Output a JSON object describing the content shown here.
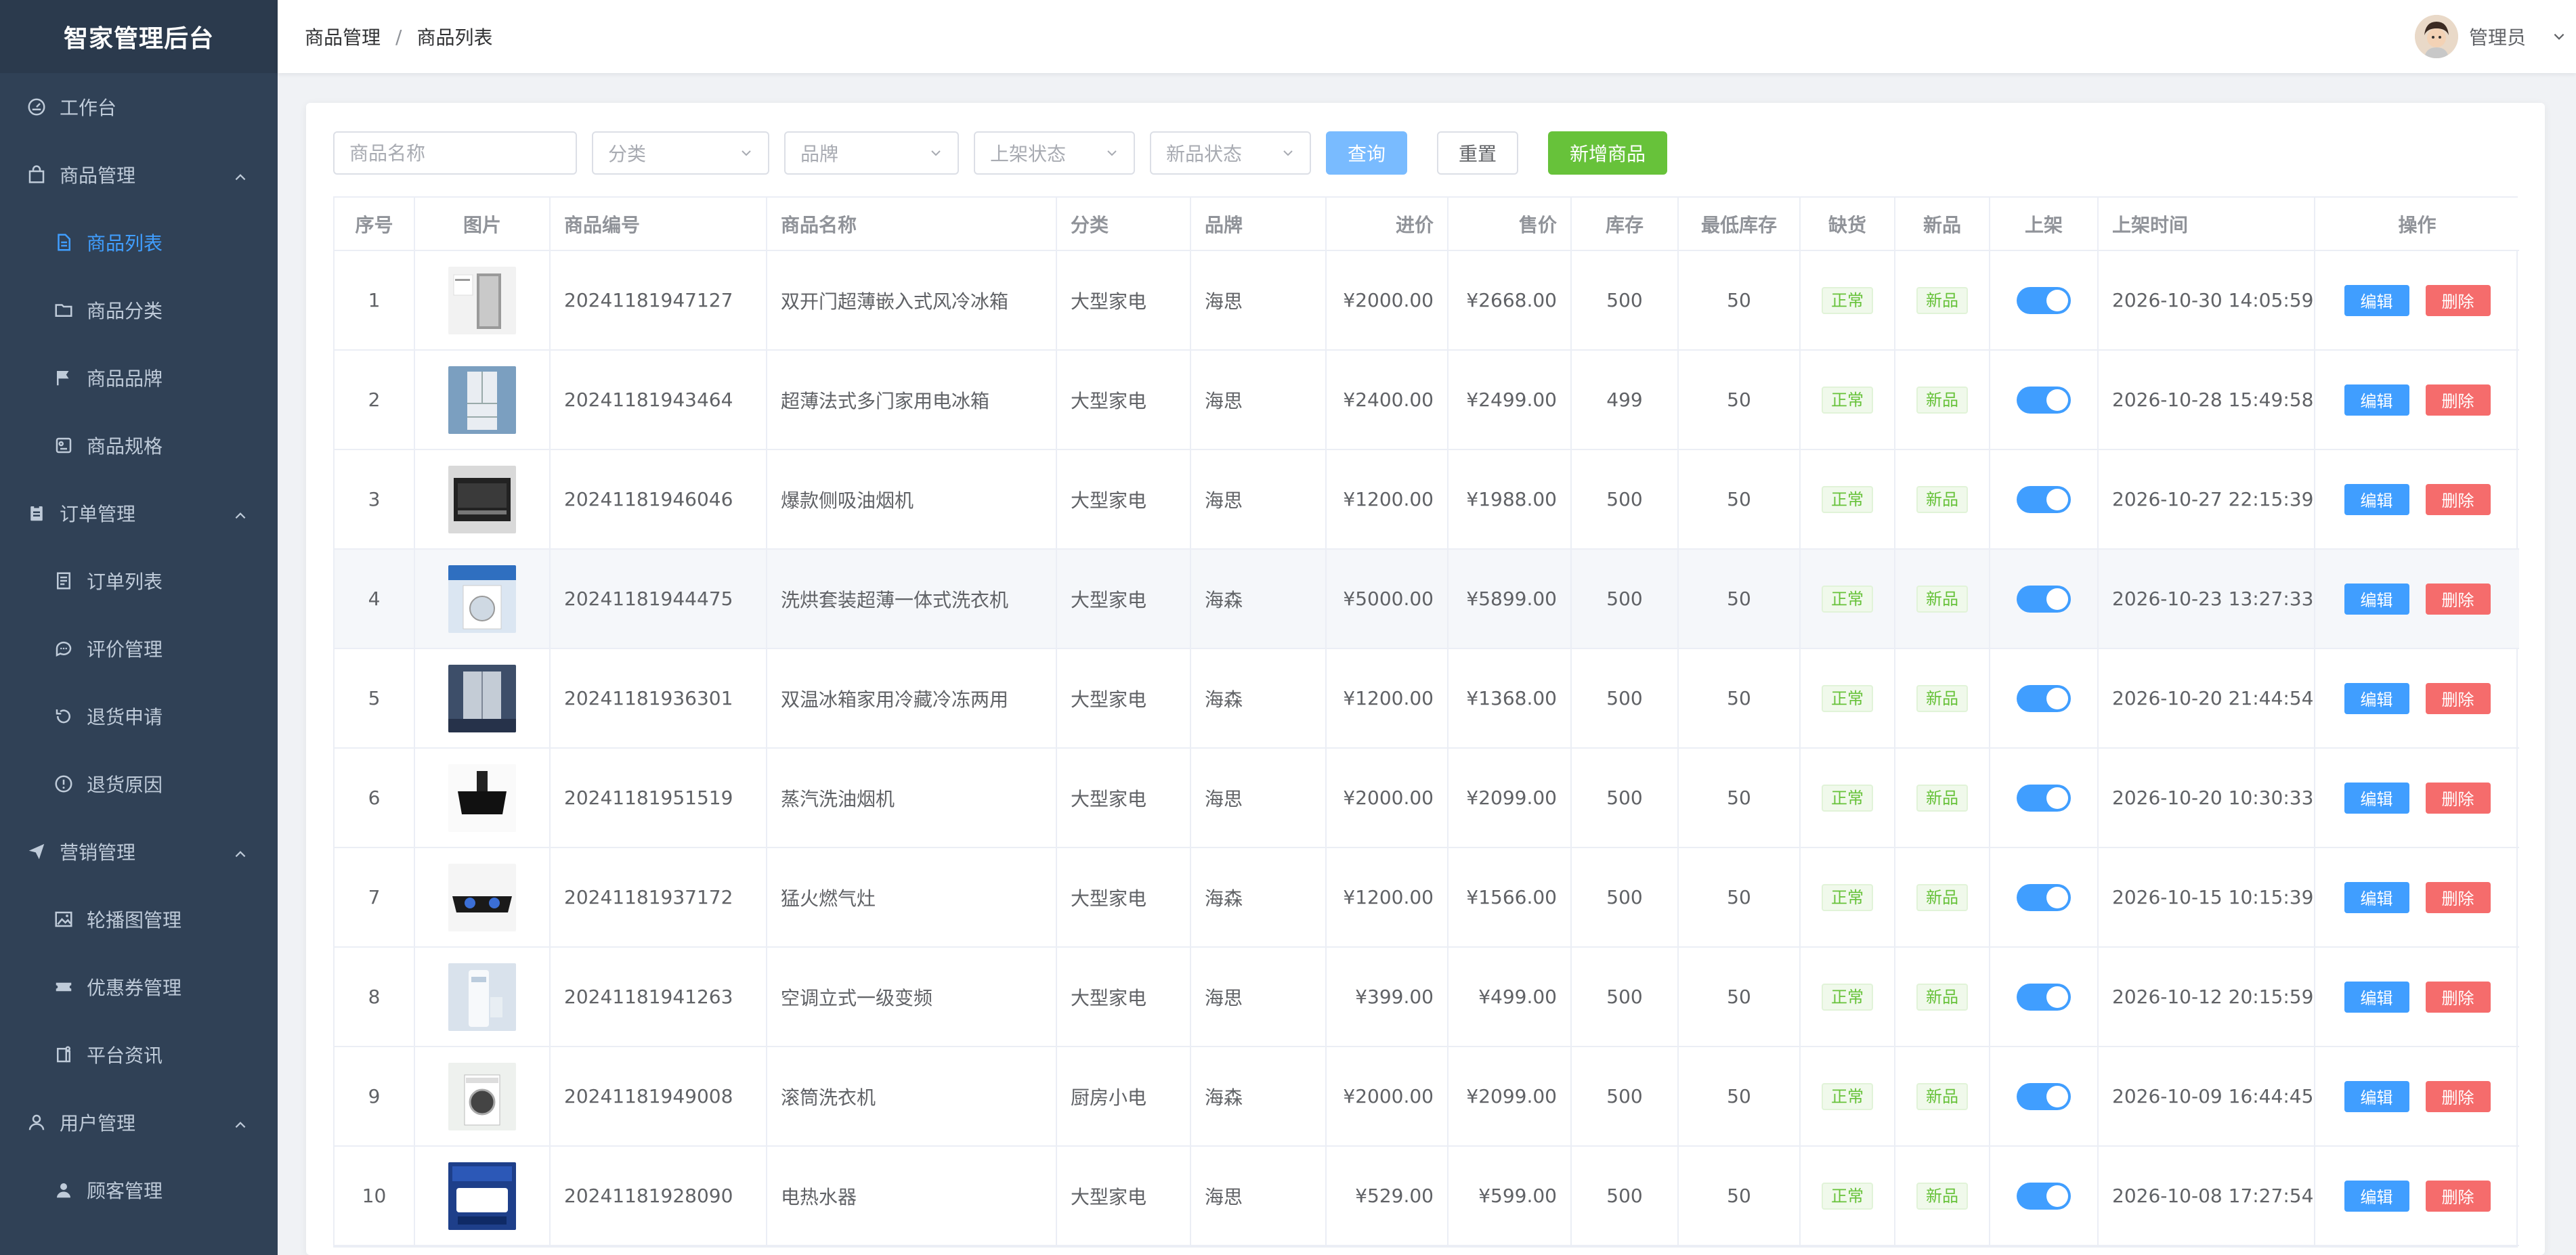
{
  "app": {
    "title": "智家管理后台"
  },
  "sidebar": {
    "items": [
      {
        "label": "工作台",
        "icon": "dashboard-icon",
        "level": "top"
      },
      {
        "label": "商品管理",
        "icon": "bag-icon",
        "level": "top",
        "expanded": true
      },
      {
        "label": "商品列表",
        "icon": "document-icon",
        "level": "sub",
        "active": true
      },
      {
        "label": "商品分类",
        "icon": "folder-icon",
        "level": "sub"
      },
      {
        "label": "商品品牌",
        "icon": "flag-icon",
        "level": "sub"
      },
      {
        "label": "商品规格",
        "icon": "spec-icon",
        "level": "sub"
      },
      {
        "label": "订单管理",
        "icon": "clipboard-icon",
        "level": "top",
        "expanded": true
      },
      {
        "label": "订单列表",
        "icon": "list-icon",
        "level": "sub"
      },
      {
        "label": "评价管理",
        "icon": "comment-icon",
        "level": "sub"
      },
      {
        "label": "退货申请",
        "icon": "return-icon",
        "level": "sub"
      },
      {
        "label": "退货原因",
        "icon": "warning-icon",
        "level": "sub"
      },
      {
        "label": "营销管理",
        "icon": "send-icon",
        "level": "top",
        "expanded": true
      },
      {
        "label": "轮播图管理",
        "icon": "image-icon",
        "level": "sub"
      },
      {
        "label": "优惠券管理",
        "icon": "ticket-icon",
        "level": "sub"
      },
      {
        "label": "平台资讯",
        "icon": "news-icon",
        "level": "sub"
      },
      {
        "label": "用户管理",
        "icon": "user-icon",
        "level": "top",
        "expanded": true
      },
      {
        "label": "顾客管理",
        "icon": "person-icon",
        "level": "sub"
      }
    ]
  },
  "header": {
    "breadcrumb": [
      "商品管理",
      "商品列表"
    ],
    "breadcrumb_separator": "/",
    "user_name": "管理员"
  },
  "filters": {
    "name_placeholder": "商品名称",
    "category_placeholder": "分类",
    "brand_placeholder": "品牌",
    "shelf_status_placeholder": "上架状态",
    "new_status_placeholder": "新品状态",
    "query_label": "查询",
    "reset_label": "重置",
    "add_label": "新增商品"
  },
  "table": {
    "columns": [
      "序号",
      "图片",
      "商品编号",
      "商品名称",
      "分类",
      "品牌",
      "进价",
      "售价",
      "库存",
      "最低库存",
      "缺货",
      "新品",
      "上架",
      "上架时间",
      "操作"
    ],
    "edit_label": "编辑",
    "delete_label": "删除",
    "rows": [
      {
        "index": "1",
        "code": "20241181947127",
        "name": "双开门超薄嵌入式风冷冰箱",
        "category": "大型家电",
        "brand": "海思",
        "cost": "¥2000.00",
        "price": "¥2668.00",
        "stock": "500",
        "min_stock": "50",
        "shortage": "正常",
        "is_new": "新品",
        "on_shelf": true,
        "time": "2026-10-30 14:05:59",
        "image": "fridge-side-icon"
      },
      {
        "index": "2",
        "code": "20241181943464",
        "name": "超薄法式多门家用电冰箱",
        "category": "大型家电",
        "brand": "海思",
        "cost": "¥2400.00",
        "price": "¥2499.00",
        "stock": "499",
        "min_stock": "50",
        "shortage": "正常",
        "is_new": "新品",
        "on_shelf": true,
        "time": "2026-10-28 15:49:58",
        "image": "fridge-front-icon"
      },
      {
        "index": "3",
        "code": "20241181946046",
        "name": "爆款侧吸油烟机",
        "category": "大型家电",
        "brand": "海思",
        "cost": "¥1200.00",
        "price": "¥1988.00",
        "stock": "500",
        "min_stock": "50",
        "shortage": "正常",
        "is_new": "新品",
        "on_shelf": true,
        "time": "2026-10-27 22:15:39",
        "image": "range-hood-icon"
      },
      {
        "index": "4",
        "code": "20241181944475",
        "name": "洗烘套装超薄一体式洗衣机",
        "category": "大型家电",
        "brand": "海森",
        "cost": "¥5000.00",
        "price": "¥5899.00",
        "stock": "500",
        "min_stock": "50",
        "shortage": "正常",
        "is_new": "新品",
        "on_shelf": true,
        "time": "2026-10-23 13:27:33",
        "image": "washer-icon"
      },
      {
        "index": "5",
        "code": "20241181936301",
        "name": "双温冰箱家用冷藏冷冻两用",
        "category": "大型家电",
        "brand": "海森",
        "cost": "¥1200.00",
        "price": "¥1368.00",
        "stock": "500",
        "min_stock": "50",
        "shortage": "正常",
        "is_new": "新品",
        "on_shelf": true,
        "time": "2026-10-20 21:44:54",
        "image": "fridge-dark-icon"
      },
      {
        "index": "6",
        "code": "20241181951519",
        "name": "蒸汽洗油烟机",
        "category": "大型家电",
        "brand": "海思",
        "cost": "¥2000.00",
        "price": "¥2099.00",
        "stock": "500",
        "min_stock": "50",
        "shortage": "正常",
        "is_new": "新品",
        "on_shelf": true,
        "time": "2026-10-20 10:30:33",
        "image": "hood-black-icon"
      },
      {
        "index": "7",
        "code": "20241181937172",
        "name": "猛火燃气灶",
        "category": "大型家电",
        "brand": "海森",
        "cost": "¥1200.00",
        "price": "¥1566.00",
        "stock": "500",
        "min_stock": "50",
        "shortage": "正常",
        "is_new": "新品",
        "on_shelf": true,
        "time": "2026-10-15 10:15:39",
        "image": "gas-stove-icon"
      },
      {
        "index": "8",
        "code": "20241181941263",
        "name": "空调立式一级变频",
        "category": "大型家电",
        "brand": "海思",
        "cost": "¥399.00",
        "price": "¥499.00",
        "stock": "500",
        "min_stock": "50",
        "shortage": "正常",
        "is_new": "新品",
        "on_shelf": true,
        "time": "2026-10-12 20:15:59",
        "image": "air-conditioner-icon"
      },
      {
        "index": "9",
        "code": "20241181949008",
        "name": "滚筒洗衣机",
        "category": "厨房小电",
        "brand": "海森",
        "cost": "¥2000.00",
        "price": "¥2099.00",
        "stock": "500",
        "min_stock": "50",
        "shortage": "正常",
        "is_new": "新品",
        "on_shelf": true,
        "time": "2026-10-09 16:44:45",
        "image": "drum-washer-icon"
      },
      {
        "index": "10",
        "code": "20241181928090",
        "name": "电热水器",
        "category": "大型家电",
        "brand": "海思",
        "cost": "¥529.00",
        "price": "¥599.00",
        "stock": "500",
        "min_stock": "50",
        "shortage": "正常",
        "is_new": "新品",
        "on_shelf": true,
        "time": "2026-10-08 17:27:54",
        "image": "water-heater-icon"
      }
    ]
  },
  "colors": {
    "sidebar_bg": "#304156",
    "sidebar_text": "#bfcbd9",
    "accent": "#409eff",
    "success": "#67c23a",
    "danger": "#f56c6c"
  }
}
